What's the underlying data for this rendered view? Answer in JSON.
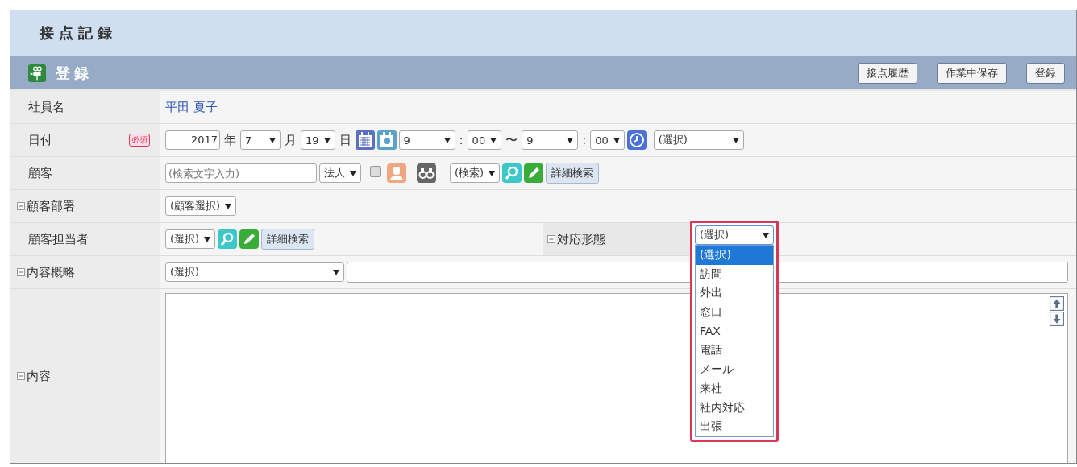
{
  "page_title": "接点記録",
  "section": {
    "title": "登録",
    "buttons": [
      "接点履歴",
      "作業中保存",
      "登録"
    ]
  },
  "rows": [
    {
      "label": "社員名",
      "items": [
        {
          "kind": "name",
          "text": "平田 夏子"
        }
      ]
    },
    {
      "label": "日付",
      "required": "必須",
      "items": [
        {
          "kind": "year",
          "value": "2017"
        },
        {
          "kind": "unit",
          "text": "年"
        },
        {
          "kind": "select",
          "value": "7"
        },
        {
          "kind": "unit",
          "text": "月"
        },
        {
          "kind": "select",
          "value": "19"
        },
        {
          "kind": "unit",
          "text": "日"
        },
        {
          "kind": "calendar"
        },
        {
          "kind": "camera-calendar"
        },
        {
          "kind": "select",
          "value": "9"
        },
        {
          "kind": "unit",
          "text": ":"
        },
        {
          "kind": "select",
          "value": "00"
        },
        {
          "kind": "unit",
          "text": "〜"
        },
        {
          "kind": "select",
          "value": "9"
        },
        {
          "kind": "unit",
          "text": ":"
        },
        {
          "kind": "select",
          "value": "00"
        },
        {
          "kind": "clock"
        },
        {
          "kind": "select",
          "value": "(選択)"
        }
      ]
    },
    {
      "label": "顧客",
      "items": [
        {
          "kind": "text-field",
          "placeholder": "(検索文字入力)"
        },
        {
          "kind": "select",
          "value": "法人"
        },
        {
          "kind": "checkbox",
          "checked": false
        },
        {
          "kind": "person"
        },
        {
          "kind": "binoculars"
        },
        {
          "kind": "select",
          "value": "(検索)"
        },
        {
          "kind": "search"
        },
        {
          "kind": "pencil"
        },
        {
          "kind": "button",
          "text": "詳細検索"
        }
      ]
    },
    {
      "label": "顧客部署",
      "expanded": true,
      "items": [
        {
          "kind": "select",
          "value": "(顧客選択)"
        }
      ]
    },
    {
      "label": "顧客担当者",
      "items": [
        {
          "kind": "select",
          "value": "(選択)"
        },
        {
          "kind": "search"
        },
        {
          "kind": "pencil"
        },
        {
          "kind": "button",
          "text": "詳細検索"
        }
      ],
      "side": {
        "label": "対応形態",
        "expanded": true,
        "value": "(選択)",
        "open": true,
        "options": [
          {
            "text": "(選択)",
            "selected": true
          },
          {
            "text": "訪問",
            "selected": false
          },
          {
            "text": "外出",
            "selected": false
          },
          {
            "text": "窓口",
            "selected": false
          },
          {
            "text": "FAX",
            "selected": false
          },
          {
            "text": "電話",
            "selected": false
          },
          {
            "text": "メール",
            "selected": false
          },
          {
            "text": "来社",
            "selected": false
          },
          {
            "text": "社内対応",
            "selected": false
          },
          {
            "text": "出張",
            "selected": false
          }
        ]
      }
    },
    {
      "label": "内容概略",
      "expanded": true,
      "items": [
        {
          "kind": "select",
          "value": "(選択)"
        },
        {
          "kind": "wide-field"
        }
      ]
    },
    {
      "label": "内容",
      "expanded": true,
      "items": [
        {
          "kind": "textarea"
        }
      ]
    }
  ]
}
